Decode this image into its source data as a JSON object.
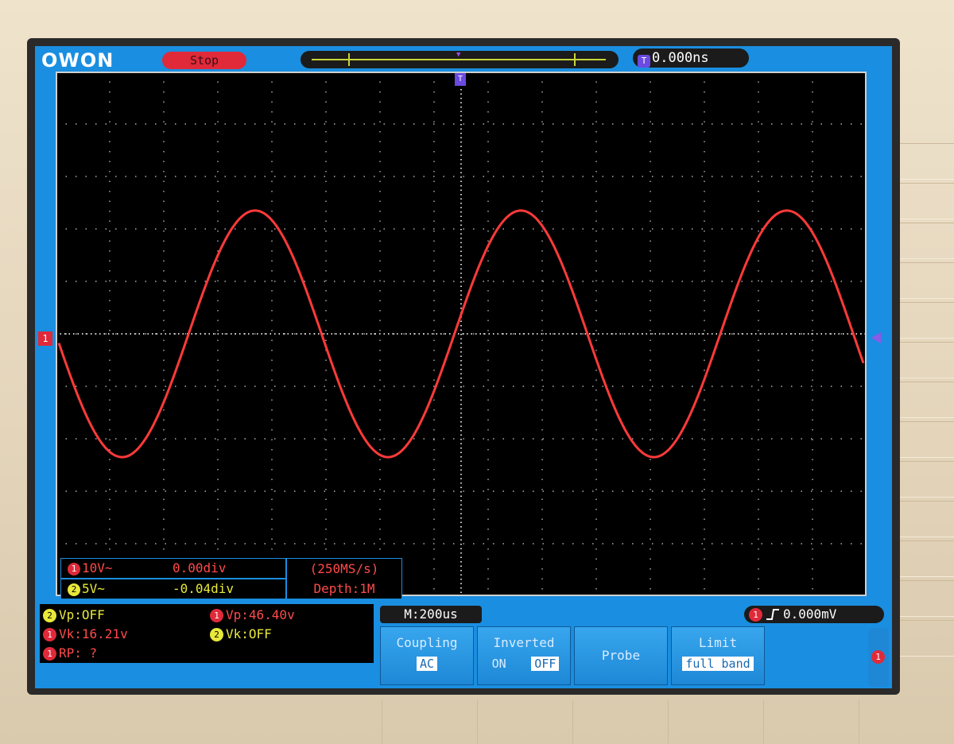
{
  "device": {
    "logo": "OWON"
  },
  "status": {
    "run_state": "Stop"
  },
  "trigger_position": {
    "icon": "T",
    "value": "0.000ns"
  },
  "colors": {
    "ch1": "#ff3a3a",
    "ch2": "#e8e83a",
    "screen_bg": "#1a8ee0",
    "grid": "#ffffff",
    "trigger_marker": "#6a4ae0"
  },
  "channel_markers": {
    "ch1": "1"
  },
  "channels": [
    {
      "num": "1",
      "scale": "10V~",
      "offset": "0.00div"
    },
    {
      "num": "2",
      "scale": "5V~",
      "offset": "-0.04div"
    }
  ],
  "acquisition": {
    "rate": "(250MS/s)",
    "depth": "Depth:1M"
  },
  "measurements": [
    {
      "num": "2",
      "text": "Vp:OFF",
      "color": "#e8e83a",
      "badge": "#e8e83a"
    },
    {
      "num": "1",
      "text": "Vp:46.40v",
      "color": "#ff4a4a",
      "badge": "#e02a3a"
    },
    {
      "num": "1",
      "text": "Vk:16.21v",
      "color": "#ff4a4a",
      "badge": "#e02a3a"
    },
    {
      "num": "2",
      "text": "Vk:OFF",
      "color": "#e8e83a",
      "badge": "#e8e83a"
    },
    {
      "num": "1",
      "text": "RP:  ?",
      "color": "#ff4a4a",
      "badge": "#e02a3a"
    }
  ],
  "timebase": {
    "label": "M:200us"
  },
  "trigger": {
    "channel": "1",
    "slope_icon": "rising-edge-icon",
    "level": "0.000mV"
  },
  "menu": [
    {
      "title": "Coupling",
      "options": [
        "AC"
      ],
      "selected": 0
    },
    {
      "title": "Inverted",
      "options": [
        "ON",
        "OFF"
      ],
      "selected": 1
    },
    {
      "title": "Probe",
      "options": [],
      "selected": -1
    },
    {
      "title": "Limit",
      "options": [
        "full band"
      ],
      "selected": 0
    }
  ],
  "side_button": {
    "num": "1"
  },
  "chart_data": {
    "type": "line",
    "grid_divisions": {
      "x": 15,
      "y": 10
    },
    "series": [
      {
        "channel": "1",
        "amplitude_div": 2.35,
        "cycles_on_screen": 3.05,
        "phase_start_div": 0.0,
        "color": "#ff3a3a"
      }
    ]
  }
}
